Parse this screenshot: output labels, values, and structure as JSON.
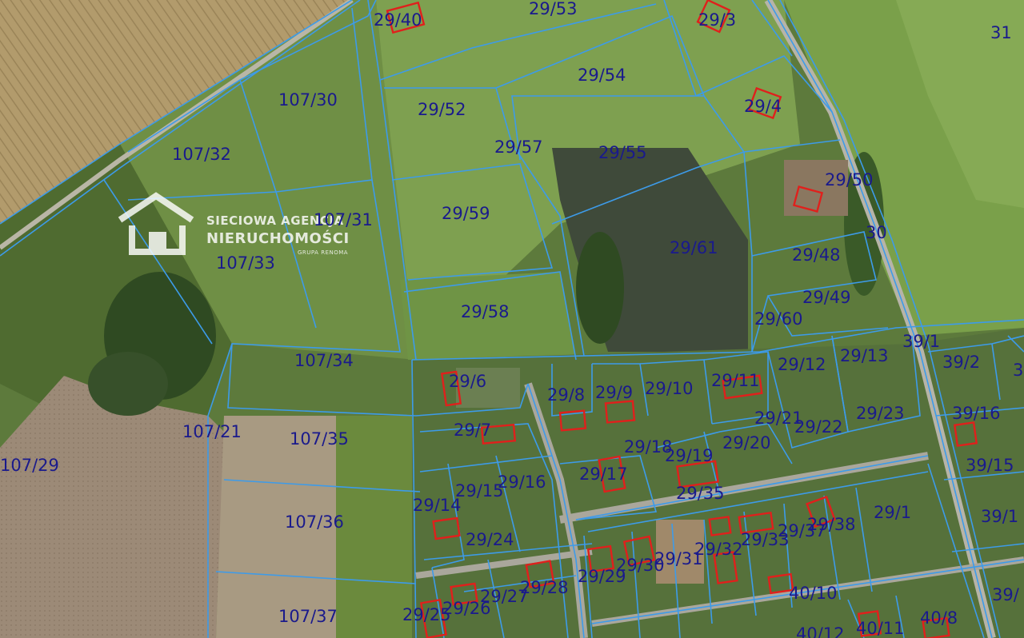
{
  "watermark": {
    "line1": "SIECIOWA AGENCJA",
    "line2": "NIERUCHOMOŚCI",
    "line3": "GRUPA RENOMA"
  },
  "colors": {
    "boundary": "#3d9be9",
    "building": "#e0201c",
    "label": "#1a1a8c"
  },
  "parcels": [
    {
      "id": "p-29-40",
      "label": "29/40"
    },
    {
      "id": "p-29-53",
      "label": "29/53"
    },
    {
      "id": "p-29-3",
      "label": "29/3"
    },
    {
      "id": "p-31",
      "label": "31"
    },
    {
      "id": "p-29-54",
      "label": "29/54"
    },
    {
      "id": "p-107-30",
      "label": "107/30"
    },
    {
      "id": "p-29-52",
      "label": "29/52"
    },
    {
      "id": "p-29-4",
      "label": "29/4"
    },
    {
      "id": "p-107-32",
      "label": "107/32"
    },
    {
      "id": "p-29-57",
      "label": "29/57"
    },
    {
      "id": "p-29-55",
      "label": "29/55"
    },
    {
      "id": "p-29-50",
      "label": "29/50"
    },
    {
      "id": "p-29-59",
      "label": "29/59"
    },
    {
      "id": "p-107-31",
      "label": "107/31"
    },
    {
      "id": "p-30",
      "label": "30"
    },
    {
      "id": "p-29-61",
      "label": "29/61"
    },
    {
      "id": "p-29-48",
      "label": "29/48"
    },
    {
      "id": "p-107-33",
      "label": "107/33"
    },
    {
      "id": "p-29-49",
      "label": "29/49"
    },
    {
      "id": "p-29-58",
      "label": "29/58"
    },
    {
      "id": "p-29-60",
      "label": "29/60"
    },
    {
      "id": "p-39-1",
      "label": "39/1"
    },
    {
      "id": "p-29-13",
      "label": "29/13"
    },
    {
      "id": "p-39-2",
      "label": "39/2"
    },
    {
      "id": "p-107-34",
      "label": "107/34"
    },
    {
      "id": "p-29-12",
      "label": "29/12"
    },
    {
      "id": "p-29-6",
      "label": "29/6"
    },
    {
      "id": "p-29-11",
      "label": "29/11"
    },
    {
      "id": "p-29-10",
      "label": "29/10"
    },
    {
      "id": "p-29-9",
      "label": "29/9"
    },
    {
      "id": "p-29-8",
      "label": "29/8"
    },
    {
      "id": "p-29-23",
      "label": "29/23"
    },
    {
      "id": "p-39-16",
      "label": "39/16"
    },
    {
      "id": "p-29-21",
      "label": "29/21"
    },
    {
      "id": "p-107-21",
      "label": "107/21"
    },
    {
      "id": "p-29-7",
      "label": "29/7"
    },
    {
      "id": "p-29-22",
      "label": "29/22"
    },
    {
      "id": "p-107-35",
      "label": "107/35"
    },
    {
      "id": "p-29-18",
      "label": "29/18"
    },
    {
      "id": "p-29-20",
      "label": "29/20"
    },
    {
      "id": "p-29-19",
      "label": "29/19"
    },
    {
      "id": "p-107-29",
      "label": "107/29"
    },
    {
      "id": "p-39-15",
      "label": "39/15"
    },
    {
      "id": "p-29-17",
      "label": "29/17"
    },
    {
      "id": "p-29-16",
      "label": "29/16"
    },
    {
      "id": "p-29-15",
      "label": "29/15"
    },
    {
      "id": "p-29-35",
      "label": "29/35"
    },
    {
      "id": "p-29-14",
      "label": "29/14"
    },
    {
      "id": "p-29-1",
      "label": "29/1"
    },
    {
      "id": "p-39-1b",
      "label": "39/1"
    },
    {
      "id": "p-107-36",
      "label": "107/36"
    },
    {
      "id": "p-29-38",
      "label": "29/38"
    },
    {
      "id": "p-29-37",
      "label": "29/37"
    },
    {
      "id": "p-29-33",
      "label": "29/33"
    },
    {
      "id": "p-29-24",
      "label": "29/24"
    },
    {
      "id": "p-29-32",
      "label": "29/32"
    },
    {
      "id": "p-29-31",
      "label": "29/31"
    },
    {
      "id": "p-29-30",
      "label": "29/30"
    },
    {
      "id": "p-29-29",
      "label": "29/29"
    },
    {
      "id": "p-29-28",
      "label": "29/28"
    },
    {
      "id": "p-40-10",
      "label": "40/10"
    },
    {
      "id": "p-29-27",
      "label": "29/27"
    },
    {
      "id": "p-39-",
      "label": "39/"
    },
    {
      "id": "p-29-26",
      "label": "29/26"
    },
    {
      "id": "p-107-37",
      "label": "107/37"
    },
    {
      "id": "p-29-25",
      "label": "29/25"
    },
    {
      "id": "p-40-8",
      "label": "40/8"
    },
    {
      "id": "p-40-11",
      "label": "40/11"
    },
    {
      "id": "p-40-12",
      "label": "40/12"
    },
    {
      "id": "p-3",
      "label": "3"
    }
  ]
}
